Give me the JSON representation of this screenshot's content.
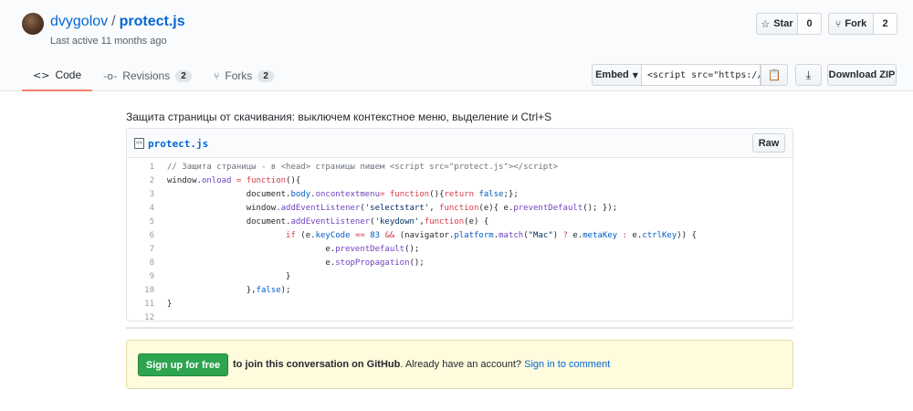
{
  "owner": "dvygolov",
  "separator": "/",
  "repo": "protect.js",
  "last_active": "Last active 11 months ago",
  "actions": {
    "star_label": "Star",
    "star_count": "0",
    "fork_label": "Fork",
    "fork_count": "2"
  },
  "tabs": [
    {
      "label": "Code",
      "icon": "code-icon",
      "active": true
    },
    {
      "label": "Revisions",
      "icon": "revisions-icon",
      "count": "2"
    },
    {
      "label": "Forks",
      "icon": "fork-icon",
      "count": "2"
    }
  ],
  "embed": {
    "label": "Embed",
    "value": "<script src=\"https://gist.github.com/dvygolov/"
  },
  "download_label": "Download ZIP",
  "description": "Защита страницы от скачивания: выключем контекстное меню, выделение и Ctrl+S",
  "file": {
    "name": "protect.js",
    "raw_label": "Raw",
    "line_numbers": [
      "1",
      "2",
      "3",
      "4",
      "5",
      "6",
      "7",
      "8",
      "9",
      "10",
      "11",
      "12"
    ]
  },
  "signup": {
    "button": "Sign up for free",
    "text_strong": "to join this conversation on GitHub",
    "text_rest": ". Already have an account? ",
    "link": "Sign in to comment"
  },
  "colors": {
    "accent_link": "#0366d6",
    "tab_underline": "#f9826c",
    "signup_green": "#2ea44f",
    "banner_bg": "#fffbdd"
  }
}
